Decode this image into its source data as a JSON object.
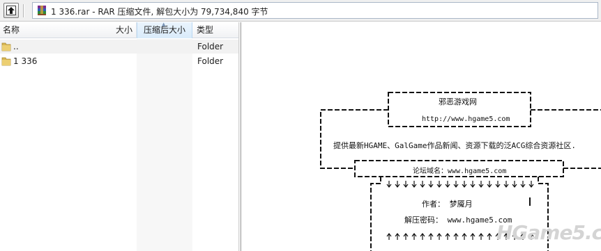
{
  "toolbar": {
    "up_icon": "up-folder-icon"
  },
  "address": {
    "archive_icon": "winrar-archive-icon",
    "text": "1 336.rar - RAR 压缩文件, 解包大小为 79,734,840 字节"
  },
  "file_list": {
    "columns": {
      "name": "名称",
      "size": "大小",
      "packed": "压缩后大小",
      "type": "类型"
    },
    "rows": [
      {
        "icon": "folder-icon",
        "name": "..",
        "type": "Folder"
      },
      {
        "icon": "folder-icon",
        "name": "1 336",
        "type": "Folder"
      }
    ]
  },
  "comment": {
    "site_name": "邪恶游戏网",
    "site_url": "http://www.hgame5.com",
    "tagline": "提供最新HGAME、GalGame作品新闻、资源下载的泛ACG综合资源社区.",
    "forum": "论坛域名：www.hgame5.com",
    "author": "作者：     梦魇月",
    "password": "解压密码：   www.hgame5.com",
    "watermark": "HGame5.com"
  }
}
